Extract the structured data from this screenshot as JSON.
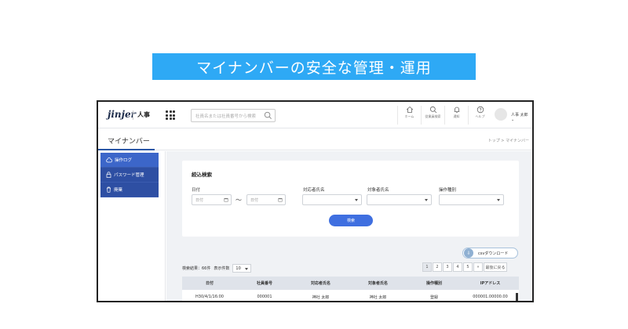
{
  "banner": {
    "title": "マイナンバーの安全な管理・運用"
  },
  "header": {
    "logo": "jinjer",
    "product": "人事",
    "search_placeholder": "社員名または社員番号から検索",
    "nav": [
      {
        "label": "ホーム",
        "icon": "home-icon"
      },
      {
        "label": "従業員検索",
        "icon": "search-icon"
      },
      {
        "label": "通知",
        "icon": "bell-icon"
      },
      {
        "label": "ヘルプ",
        "icon": "help-icon"
      }
    ],
    "user": "人事 太郎 ⌄"
  },
  "subheader": {
    "title": "マイナンバー",
    "breadcrumb": "トップ > マイナンバー"
  },
  "sidebar": {
    "items": [
      {
        "label": "操作ログ",
        "icon": "cloud-icon"
      },
      {
        "label": "パスワード管理",
        "icon": "lock-icon"
      },
      {
        "label": "廃棄",
        "icon": "trash-icon"
      }
    ]
  },
  "filter": {
    "title": "絞込検索",
    "date_label": "日付",
    "date_from_placeholder": "日付",
    "date_to_placeholder": "日付",
    "tilde": "〜",
    "handler_label": "対応者氏名",
    "target_label": "対象者氏名",
    "operation_label": "操作種別",
    "search_button": "検索"
  },
  "csv_button": "csvダウンロード",
  "results": {
    "count_text": "検索結果：66件",
    "per_page_label": "表示件数",
    "per_page_value": "10",
    "pages": [
      "1",
      "2",
      "3",
      "4",
      "5",
      "»"
    ],
    "last_label": "最後に戻る"
  },
  "table": {
    "headers": [
      "日付",
      "社員番号",
      "対応者氏名",
      "対象者氏名",
      "操作種別",
      "IPアドレス"
    ],
    "rows": [
      [
        "H30/4/1/16:00",
        "000001",
        "神社 太郎",
        "神社 太郎",
        "登録",
        "000001.00000.00"
      ]
    ]
  }
}
